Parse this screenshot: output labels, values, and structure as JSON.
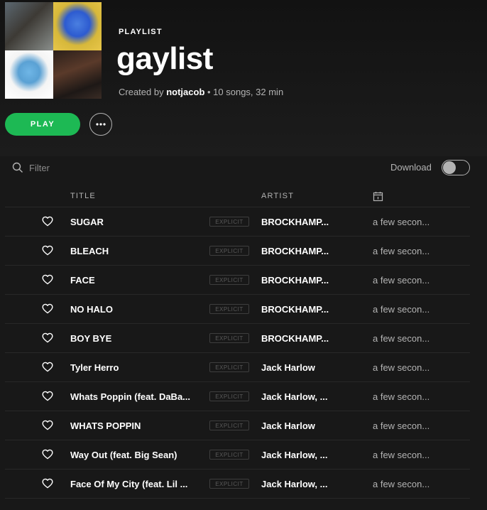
{
  "playlist": {
    "type_label": "PLAYLIST",
    "title": "gaylist",
    "created_by_label": "Created by",
    "owner": "notjacob",
    "summary": " • 10 songs, 32 min"
  },
  "controls": {
    "play_label": "PLAY",
    "filter_placeholder": "Filter",
    "download_label": "Download",
    "download_enabled": false
  },
  "columns": {
    "title": "TITLE",
    "artist": "ARTIST"
  },
  "tracks": [
    {
      "title": "SUGAR",
      "explicit": "EXPLICIT",
      "artist": "BROCKHAMP...",
      "added": "a few secon..."
    },
    {
      "title": "BLEACH",
      "explicit": "EXPLICIT",
      "artist": "BROCKHAMP...",
      "added": "a few secon..."
    },
    {
      "title": "FACE",
      "explicit": "EXPLICIT",
      "artist": "BROCKHAMP...",
      "added": "a few secon..."
    },
    {
      "title": "NO HALO",
      "explicit": "EXPLICIT",
      "artist": "BROCKHAMP...",
      "added": "a few secon..."
    },
    {
      "title": "BOY BYE",
      "explicit": "EXPLICIT",
      "artist": "BROCKHAMP...",
      "added": "a few secon..."
    },
    {
      "title": "Tyler Herro",
      "explicit": "EXPLICIT",
      "artist": "Jack Harlow",
      "added": "a few secon..."
    },
    {
      "title": "Whats Poppin (feat. DaBa...",
      "explicit": "EXPLICIT",
      "artist": "Jack Harlow, ...",
      "added": "a few secon..."
    },
    {
      "title": "WHATS POPPIN",
      "explicit": "EXPLICIT",
      "artist": "Jack Harlow",
      "added": "a few secon..."
    },
    {
      "title": "Way Out (feat. Big Sean)",
      "explicit": "EXPLICIT",
      "artist": "Jack Harlow, ...",
      "added": "a few secon..."
    },
    {
      "title": "Face Of My City (feat. Lil ...",
      "explicit": "EXPLICIT",
      "artist": "Jack Harlow, ...",
      "added": "a few secon..."
    }
  ],
  "colors": {
    "accent": "#1db954",
    "background": "#181818",
    "muted_text": "#b3b3b3"
  },
  "icons": {
    "search": "search-icon",
    "more": "more-dots-icon",
    "heart": "heart-outline-icon",
    "date_added": "calendar-icon"
  }
}
